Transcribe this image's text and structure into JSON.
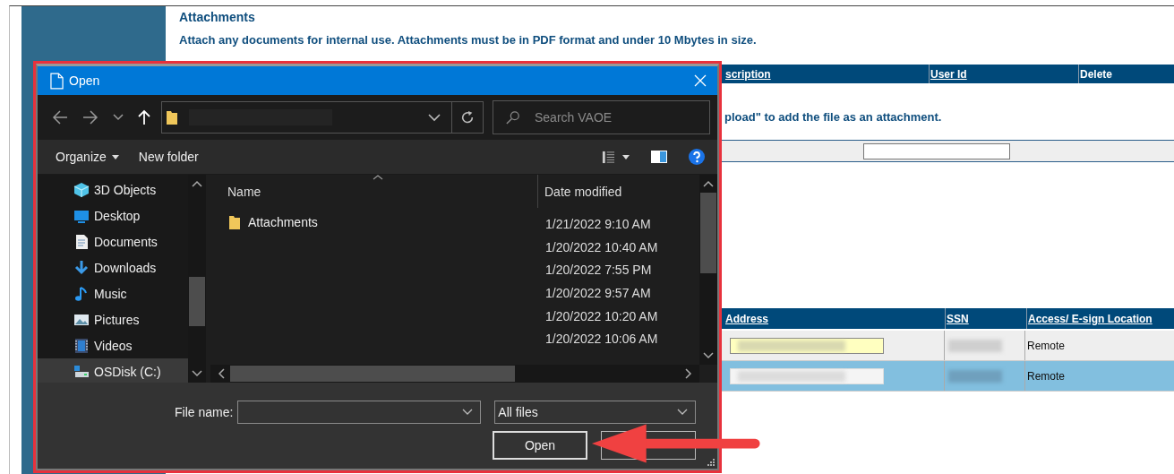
{
  "page": {
    "title": "Attachments",
    "instructions": "Attach any documents for internal use. Attachments must be in PDF format and under 10 Mbytes in size.",
    "attachments_table": {
      "columns": [
        "scription",
        "User Id",
        "Delete"
      ]
    },
    "upload_hint": "pload\" to add the file as an attachment.",
    "signers_table": {
      "columns": [
        "Address",
        "SSN",
        "Access/ E-sign Location"
      ],
      "rows": [
        {
          "selected": false,
          "column_3": "Remote"
        },
        {
          "selected": true,
          "column_3": "Remote"
        }
      ]
    }
  },
  "dialog": {
    "title": "Open",
    "search": {
      "placeholder": "Search VAOE"
    },
    "toolbar": {
      "organize": "Organize",
      "new_folder": "New folder"
    },
    "nav_items": [
      {
        "label": "3D Objects",
        "selected": false
      },
      {
        "label": "Desktop",
        "selected": false
      },
      {
        "label": "Documents",
        "selected": false
      },
      {
        "label": "Downloads",
        "selected": false
      },
      {
        "label": "Music",
        "selected": false
      },
      {
        "label": "Pictures",
        "selected": false
      },
      {
        "label": "Videos",
        "selected": false
      },
      {
        "label": "OSDisk (C:)",
        "selected": true
      }
    ],
    "columns": [
      "Name",
      "Date modified"
    ],
    "files": [
      {
        "name": "Attachments",
        "date": "1/21/2022 9:10 AM"
      },
      {
        "date": "1/20/2022 10:40 AM"
      },
      {
        "date": "1/20/2022 7:55 PM"
      },
      {
        "date": "1/20/2022 9:57 AM"
      },
      {
        "date": "1/20/2022 10:20 AM"
      },
      {
        "date": "1/20/2022 10:06 AM"
      }
    ],
    "file_name": {
      "label": "File name:"
    },
    "file_type": "All files",
    "buttons": [
      "Open"
    ]
  }
}
